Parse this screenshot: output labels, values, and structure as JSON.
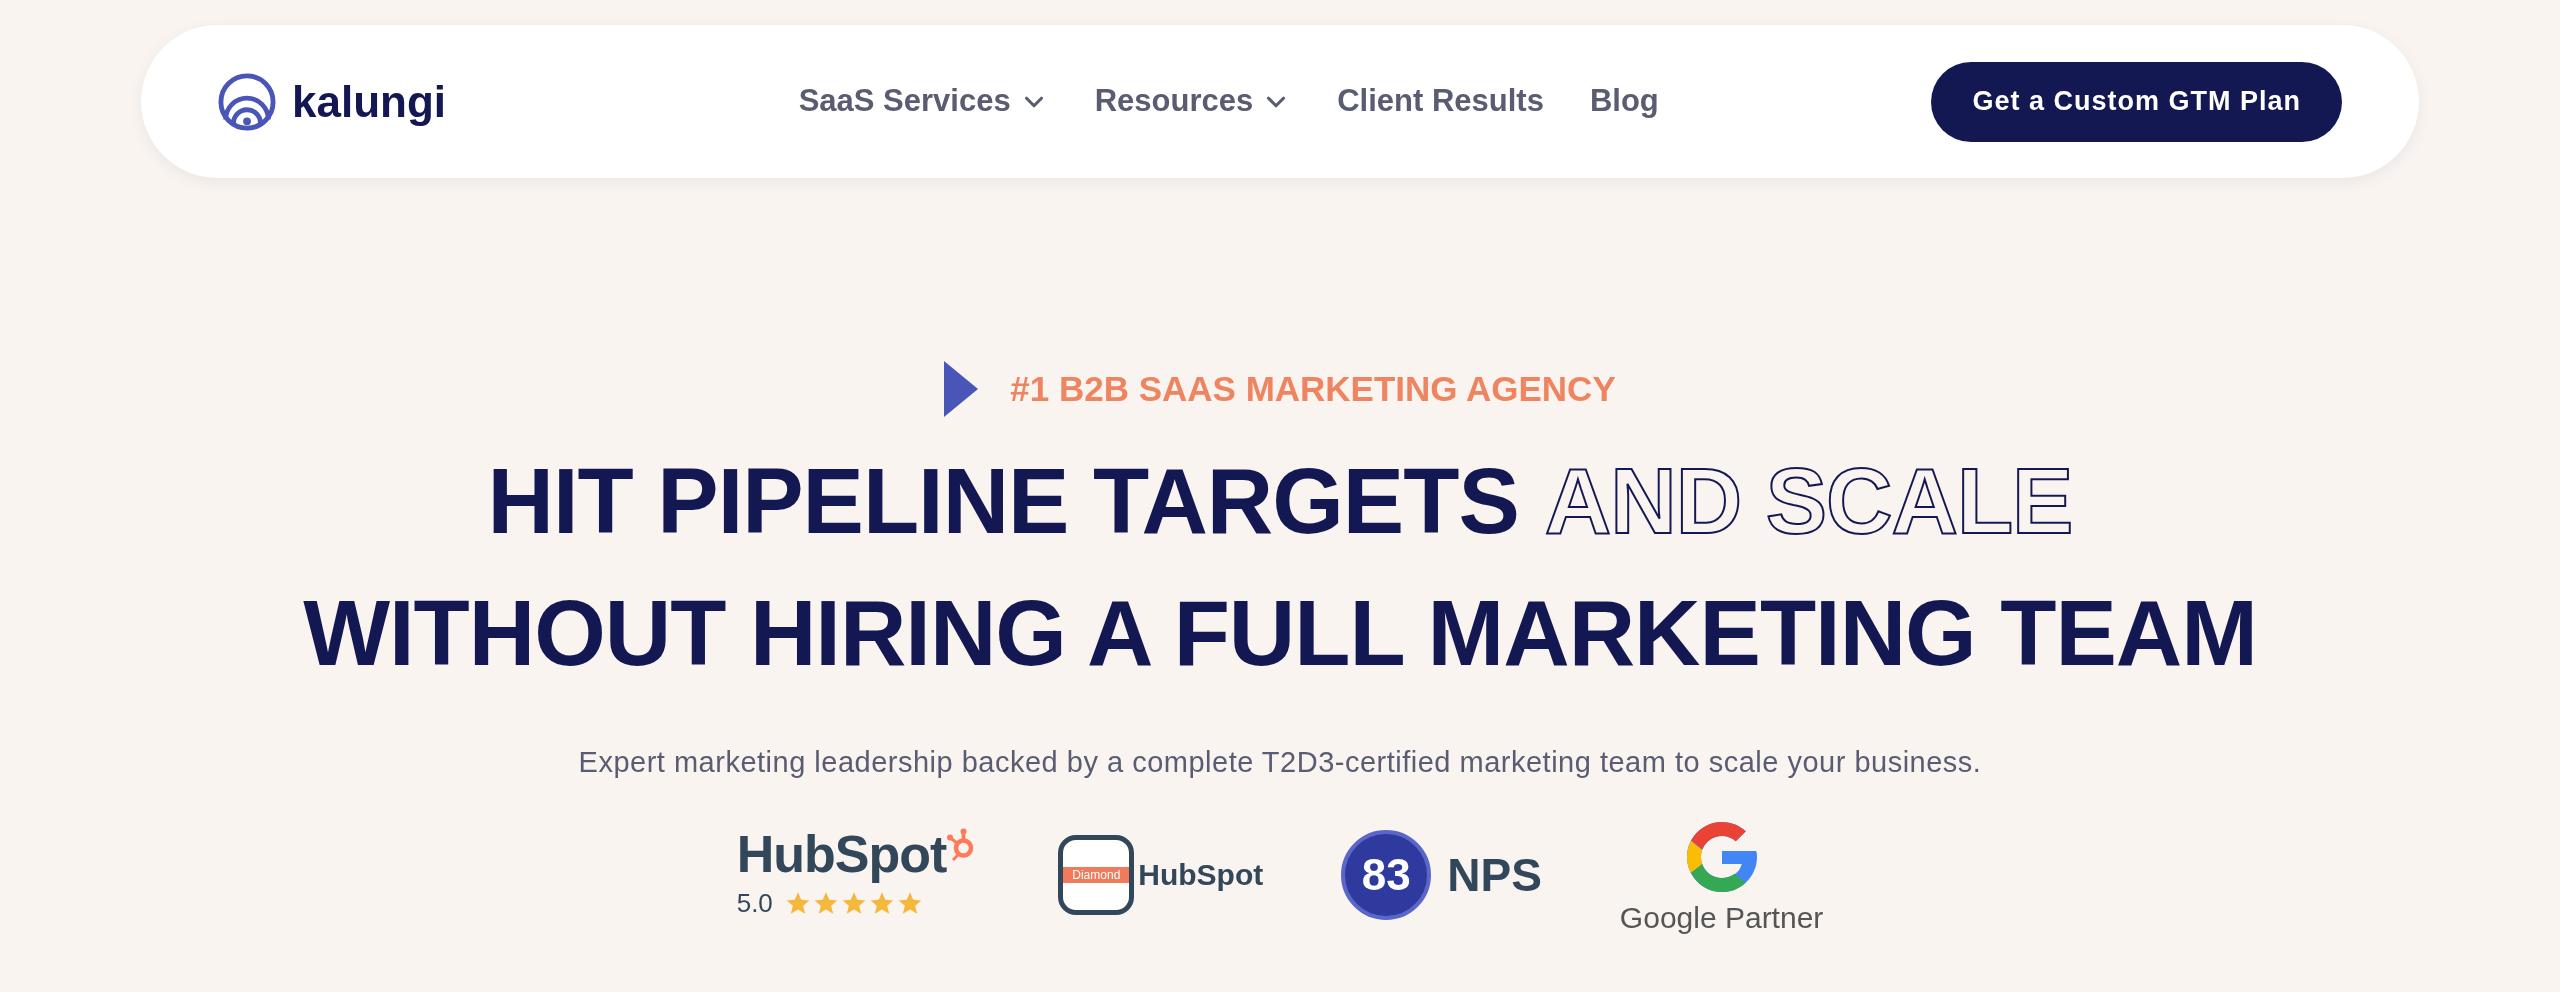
{
  "nav": {
    "brand": "kalungi",
    "links": [
      {
        "label": "SaaS Services",
        "dropdown": true
      },
      {
        "label": "Resources",
        "dropdown": true
      },
      {
        "label": "Client Results",
        "dropdown": false
      },
      {
        "label": "Blog",
        "dropdown": false
      }
    ],
    "cta": "Get a Custom GTM Plan"
  },
  "hero": {
    "eyebrow": "#1 B2B SAAS MARKETING AGENCY",
    "headline": [
      [
        {
          "text": "HIT PIPELINE TARGETS",
          "kind": "solid"
        },
        {
          "text": "AND SCALE",
          "kind": "outline"
        }
      ],
      [
        {
          "text": "WITHOUT HIRING A FULL MARKETING TEAM",
          "kind": "solid"
        }
      ]
    ],
    "subtitle": "Expert marketing leadership backed by a complete T2D3-certified marketing team to scale your business."
  },
  "badges": [
    {
      "kind": "rating",
      "logo": "HubSpot",
      "score": "5.0",
      "stars": 5
    },
    {
      "kind": "partner",
      "tier": "Diamond",
      "logo": "HubSpot"
    },
    {
      "kind": "nps",
      "score": "83",
      "label": "NPS"
    },
    {
      "kind": "google",
      "label": "Google Partner"
    }
  ]
}
